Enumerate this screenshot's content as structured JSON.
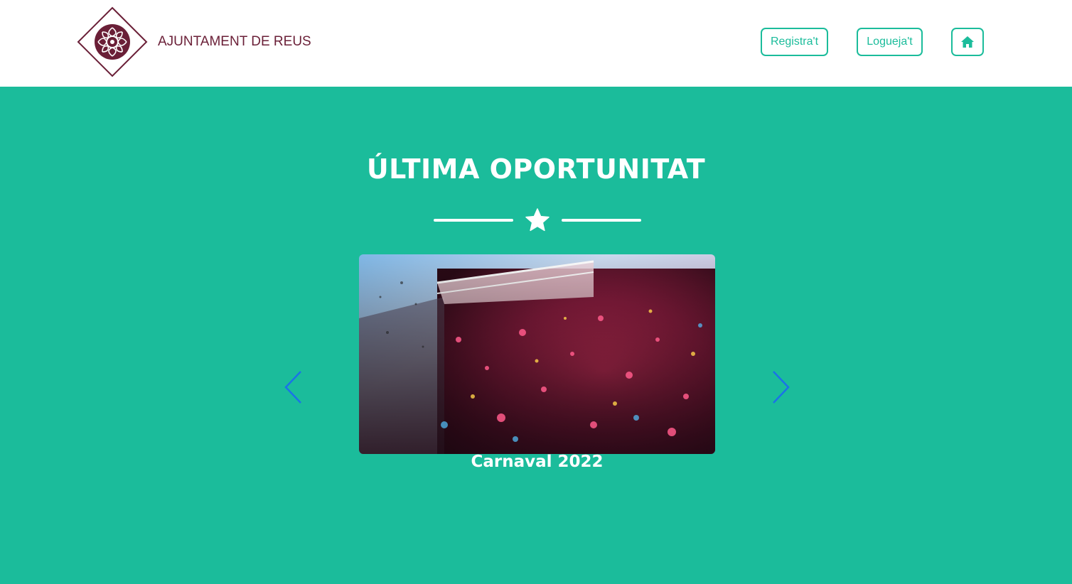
{
  "header": {
    "logo_text": "AJUNTAMENT DE REUS",
    "register_label": "Registra't",
    "login_label": "Logueja't",
    "home_icon": "home-icon"
  },
  "main": {
    "title": "ÚLTIMA OPORTUNITAT",
    "divider_icon": "star-icon",
    "carousel": {
      "prev_icon": "chevron-left-icon",
      "next_icon": "chevron-right-icon",
      "slides": [
        {
          "caption": "Carnaval 2022"
        }
      ]
    }
  },
  "colors": {
    "accent": "#1bbc9b",
    "brand": "#6a1f37",
    "arrow": "#1a73e8"
  }
}
